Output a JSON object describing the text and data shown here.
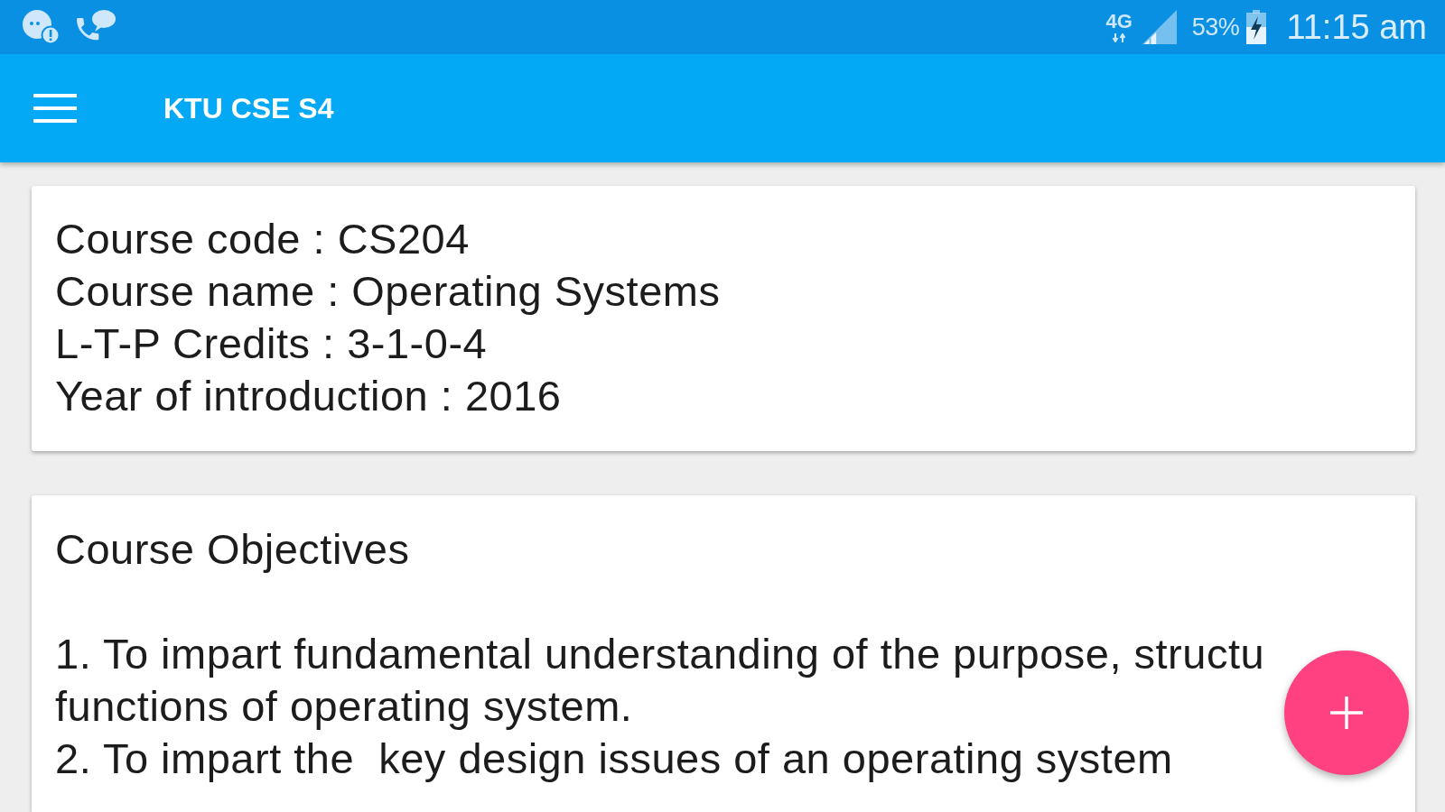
{
  "status_bar": {
    "network": "4G",
    "battery": "53%",
    "time": "11:15 am"
  },
  "app_bar": {
    "title": "KTU CSE S4"
  },
  "info_card": {
    "lines": [
      "Course code : CS204",
      "Course name : Operating Systems",
      "L-T-P Credits : 3-1-0-4",
      "Year of introduction : 2016"
    ]
  },
  "objectives_card": {
    "heading": "Course Objectives",
    "lines": [
      "1. To impart fundamental understanding of the purpose, structu",
      "functions of operating system.",
      "2. To impart the  key design issues of an operating system"
    ]
  }
}
